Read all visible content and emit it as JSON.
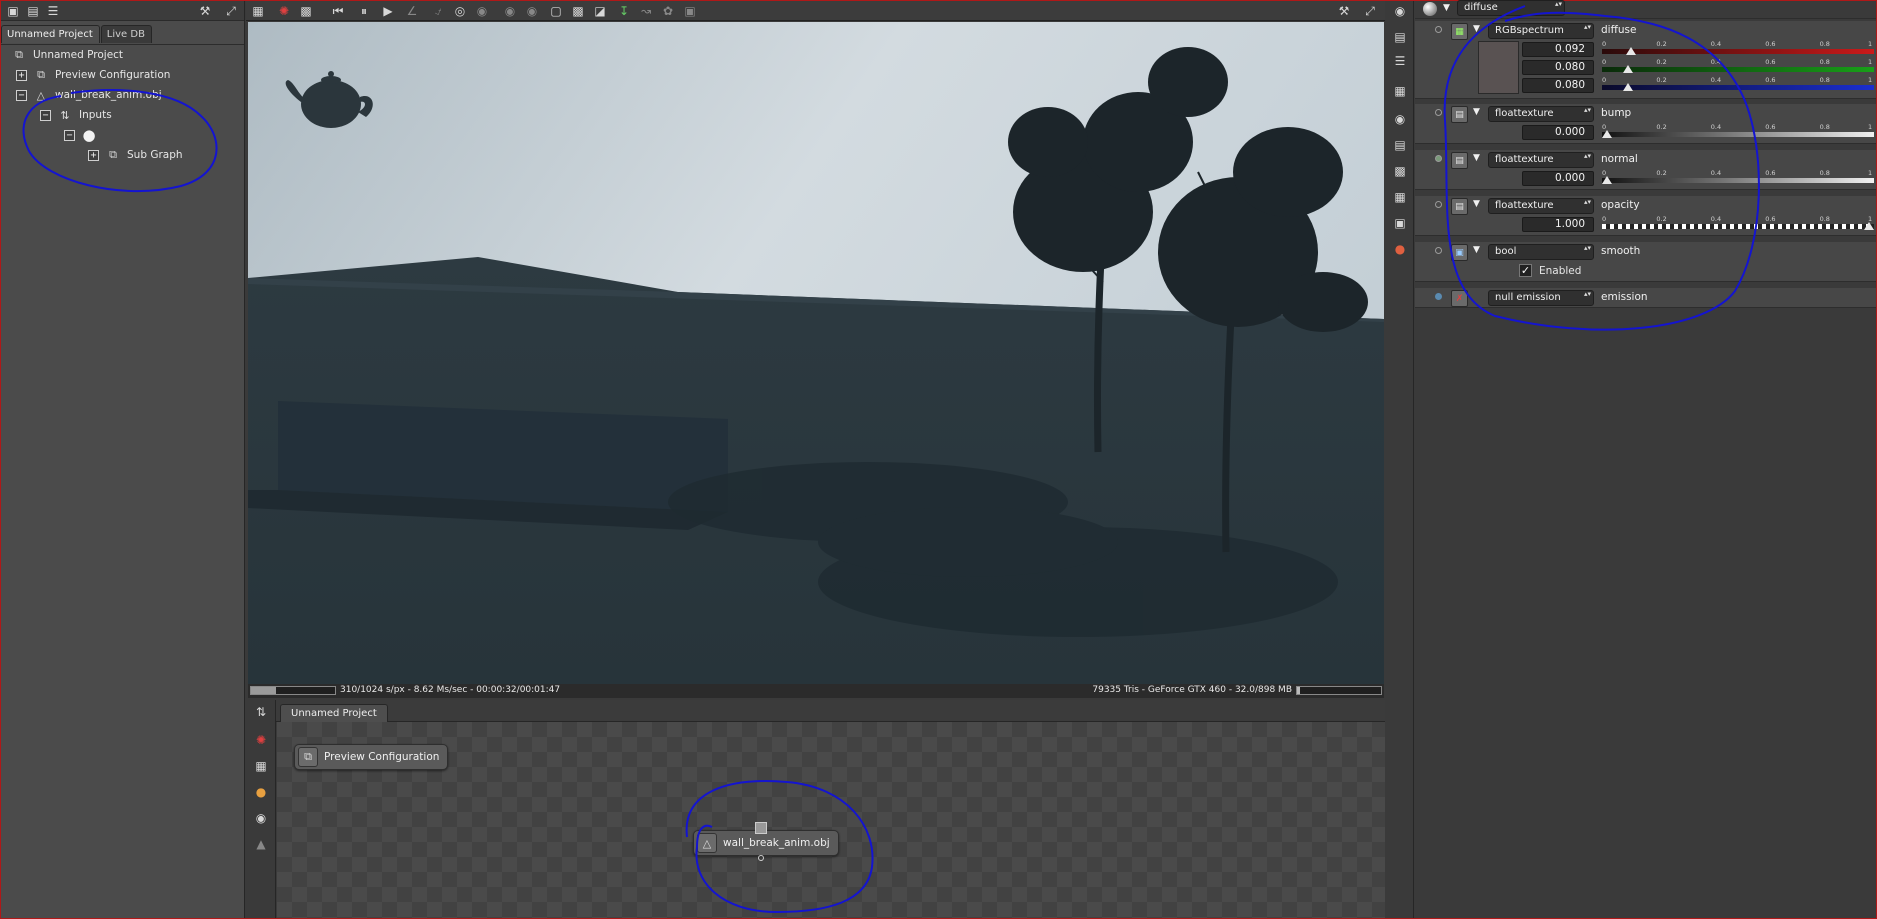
{
  "left": {
    "tabs": [
      "Unnamed Project",
      "Live DB"
    ],
    "tree": {
      "root": "Unnamed Project",
      "items": [
        "Preview Configuration",
        "wall_break_anim.obj",
        "Inputs",
        "Sub Graph"
      ]
    }
  },
  "viewport": {
    "status_left": "310/1024 s/px - 8.62 Ms/sec - 00:00:32/00:01:47",
    "status_right": "79335 Tris - GeForce GTX 460 - 32.0/898 MB",
    "progress": 0.3
  },
  "graph": {
    "tab": "Unnamed Project",
    "nodes": [
      "Preview Configuration",
      "wall_break_anim.obj"
    ]
  },
  "material": {
    "header_combo": "diffuse",
    "rows": [
      {
        "type": "RGBspectrum",
        "label": "diffuse",
        "values": [
          "0.092",
          "0.080",
          "0.080"
        ]
      },
      {
        "type": "floattexture",
        "label": "bump",
        "value": "0.000"
      },
      {
        "type": "floattexture",
        "label": "normal",
        "value": "0.000"
      },
      {
        "type": "floattexture",
        "label": "opacity",
        "value": "1.000"
      },
      {
        "type": "bool",
        "label": "smooth",
        "checkbox": "Enabled"
      },
      {
        "type": "null emission",
        "label": "emission"
      }
    ],
    "ticks": [
      "0",
      "0.2",
      "0.4",
      "0.6",
      "0.8",
      "1"
    ],
    "slider_values": [
      0.092,
      0.08,
      0.08,
      0.0,
      0.0,
      1.0
    ]
  },
  "colors": {
    "annotation": "#1414d0",
    "frame": "#b01818",
    "red_channel": "#cc1a1a",
    "green_channel": "#18a018",
    "blue_channel": "#1a2ed0"
  }
}
